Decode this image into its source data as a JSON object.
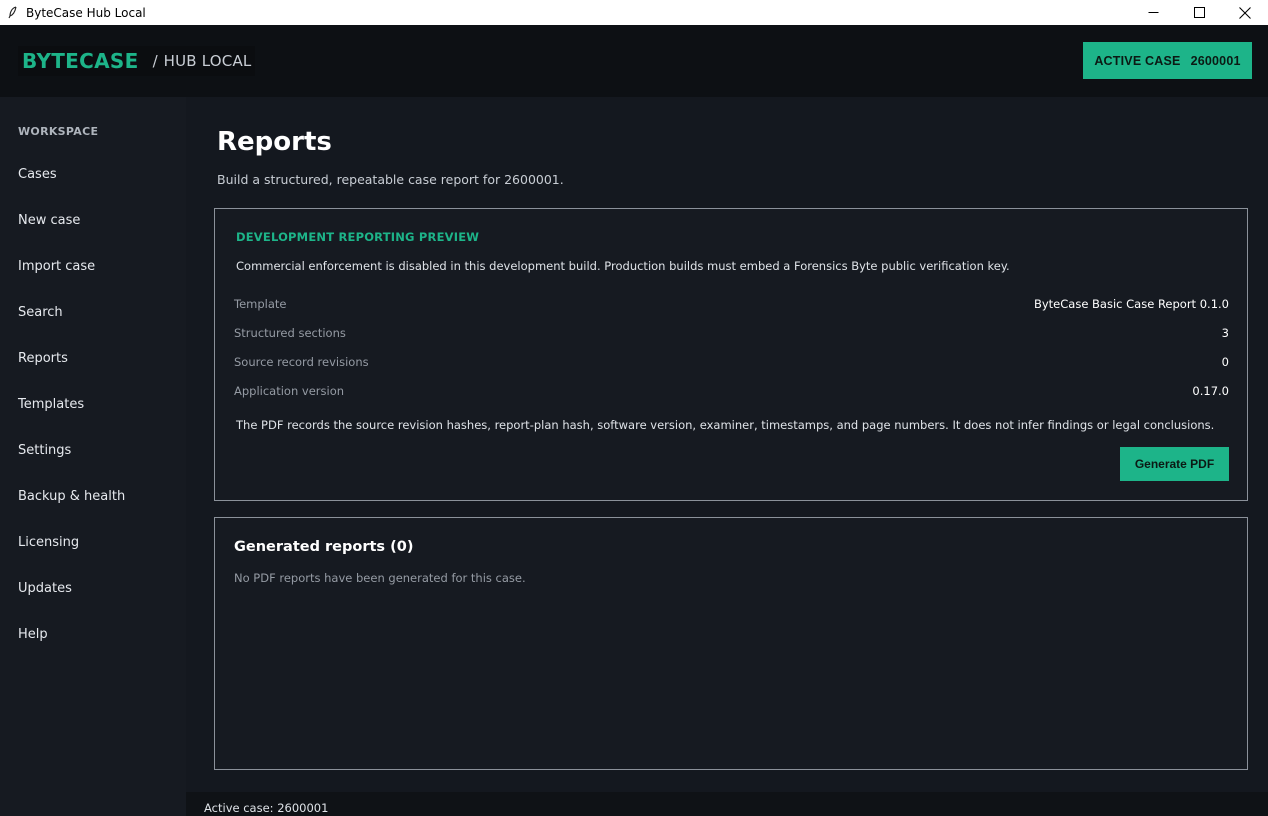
{
  "window": {
    "title": "ByteCase Hub Local",
    "controls": [
      "minimize-icon",
      "maximize-icon",
      "close-icon"
    ]
  },
  "header": {
    "brand": "BYTECASE",
    "separator": "/",
    "subtitle": "HUB LOCAL",
    "active_case_label": "ACTIVE CASE",
    "active_case_number": "2600001"
  },
  "sidebar": {
    "section": "WORKSPACE",
    "items": [
      {
        "label": "Cases"
      },
      {
        "label": "New case"
      },
      {
        "label": "Import case"
      },
      {
        "label": "Search"
      },
      {
        "label": "Reports"
      },
      {
        "label": "Templates"
      },
      {
        "label": "Settings"
      },
      {
        "label": "Backup & health"
      },
      {
        "label": "Licensing"
      },
      {
        "label": "Updates"
      },
      {
        "label": "Help"
      }
    ]
  },
  "main": {
    "title": "Reports",
    "subtitle": "Build a structured, repeatable case report for 2600001.",
    "preview": {
      "label": "DEVELOPMENT REPORTING PREVIEW",
      "description": "Commercial enforcement is disabled in this development build. Production builds must embed a Forensics Byte public verification key.",
      "rows": [
        {
          "key": "Template",
          "value": "ByteCase Basic Case Report 0.1.0"
        },
        {
          "key": "Structured sections",
          "value": "3"
        },
        {
          "key": "Source record revisions",
          "value": "0"
        },
        {
          "key": "Application version",
          "value": "0.17.0"
        }
      ],
      "footnote": "The PDF records the source revision hashes, report-plan hash, software version, examiner, timestamps, and page numbers. It does not infer findings or legal conclusions.",
      "button": "Generate PDF"
    },
    "generated": {
      "title": "Generated reports (0)",
      "empty": "No PDF reports have been generated for this case."
    }
  },
  "statusbar": {
    "text": "Active case: 2600001"
  },
  "colors": {
    "accent": "#1db489",
    "background": "#14181f",
    "sidebar": "#161a21",
    "header": "#0d1014"
  }
}
